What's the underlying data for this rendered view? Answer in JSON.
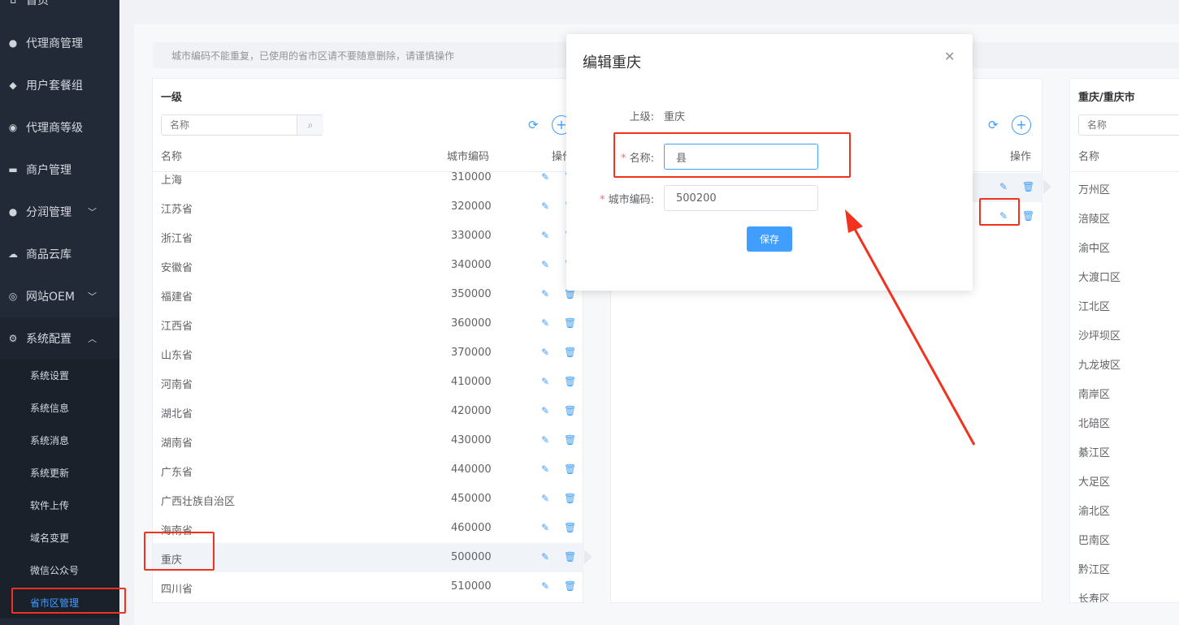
{
  "sidebar": {
    "items": [
      {
        "label": "首页",
        "icon": "home-icon"
      },
      {
        "label": "代理商管理",
        "icon": "user-icon"
      },
      {
        "label": "用户套餐组",
        "icon": "layers-icon"
      },
      {
        "label": "代理商等级",
        "icon": "medal-icon"
      },
      {
        "label": "商户管理",
        "icon": "store-icon"
      },
      {
        "label": "分润管理",
        "icon": "money-icon"
      },
      {
        "label": "商品云库",
        "icon": "cloud-icon"
      },
      {
        "label": "网站OEM",
        "icon": "globe-icon"
      },
      {
        "label": "系统配置",
        "icon": "settings-icon"
      }
    ],
    "sub_items": [
      "系统设置",
      "系统信息",
      "系统消息",
      "系统更新",
      "软件上传",
      "域名变更",
      "微信公众号",
      "省市区管理"
    ]
  },
  "notice": "城市编码不能重复，已使用的省市区请不要随意删除，请谨慎操作",
  "level1": {
    "title": "一级",
    "search_placeholder": "名称",
    "col_name": "名称",
    "col_code": "城市编码",
    "col_ops": "操作",
    "rows": [
      {
        "name": "上海",
        "code": "310000"
      },
      {
        "name": "江苏省",
        "code": "320000"
      },
      {
        "name": "浙江省",
        "code": "330000"
      },
      {
        "name": "安徽省",
        "code": "340000"
      },
      {
        "name": "福建省",
        "code": "350000"
      },
      {
        "name": "江西省",
        "code": "360000"
      },
      {
        "name": "山东省",
        "code": "370000"
      },
      {
        "name": "河南省",
        "code": "410000"
      },
      {
        "name": "湖北省",
        "code": "420000"
      },
      {
        "name": "湖南省",
        "code": "430000"
      },
      {
        "name": "广东省",
        "code": "440000"
      },
      {
        "name": "广西壮族自治区",
        "code": "450000"
      },
      {
        "name": "海南省",
        "code": "460000"
      },
      {
        "name": "重庆",
        "code": "500000"
      },
      {
        "name": "四川省",
        "code": "510000"
      }
    ]
  },
  "level2": {
    "col_ops": "操作"
  },
  "level3": {
    "title": "重庆/重庆市",
    "search_placeholder": "名称",
    "col_name": "名称",
    "rows": [
      "万州区",
      "涪陵区",
      "渝中区",
      "大渡口区",
      "江北区",
      "沙坪坝区",
      "九龙坡区",
      "南岸区",
      "北碚区",
      "綦江区",
      "大足区",
      "渝北区",
      "巴南区",
      "黔江区",
      "长寿区"
    ]
  },
  "modal": {
    "title": "编辑重庆",
    "parent_label": "上级:",
    "parent_value": "重庆",
    "name_label": "名称:",
    "name_value": "县",
    "code_label": "城市编码:",
    "code_value": "500200",
    "save_label": "保存"
  },
  "colors": {
    "accent": "#409eff",
    "annotation": "#f2311f",
    "sidebar": "#232a37"
  }
}
